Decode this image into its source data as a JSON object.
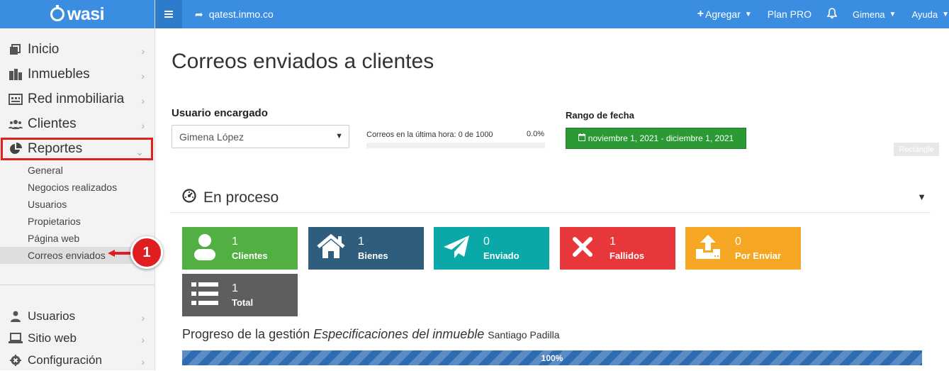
{
  "brand": {
    "name": "wasi"
  },
  "sidebar": {
    "items": [
      {
        "label": "Inicio",
        "icon": "home-icon"
      },
      {
        "label": "Inmuebles",
        "icon": "building-icon"
      },
      {
        "label": "Red inmobiliaria",
        "icon": "network-icon"
      },
      {
        "label": "Clientes",
        "icon": "users-icon"
      },
      {
        "label": "Reportes",
        "icon": "pie-chart-icon",
        "expanded": true
      }
    ],
    "reportes_sub": [
      "General",
      "Negocios realizados",
      "Usuarios",
      "Propietarios",
      "Página web",
      "Correos enviados"
    ],
    "bottom_items": [
      {
        "label": "Usuarios",
        "icon": "user-icon"
      },
      {
        "label": "Sitio web",
        "icon": "laptop-icon"
      },
      {
        "label": "Configuración",
        "icon": "gear-icon"
      }
    ],
    "callout_number": "1"
  },
  "topbar": {
    "site": "qatest.inmo.co",
    "add_label": "Agregar",
    "plan_label": "Plan PRO",
    "user_label": "Gimena",
    "help_label": "Ayuda"
  },
  "main": {
    "title": "Correos enviados a clientes",
    "user_filter_label": "Usuario encargado",
    "user_selected": "Gimena López",
    "hour_text": "Correos en la última hora: 0 de 1000",
    "hour_pct": "0.0%",
    "hour_progress": 0,
    "range_label": "Rango de fecha",
    "date_range": "noviembre 1, 2021 - diciembre 1, 2021",
    "rect_label": "Rectangle",
    "section_title": "En proceso",
    "tiles": [
      {
        "value": "1",
        "label": "Clientes",
        "color": "#52b043",
        "icon": "user-icon"
      },
      {
        "value": "1",
        "label": "Bienes",
        "color": "#2f5d7e",
        "icon": "house-icon"
      },
      {
        "value": "0",
        "label": "Enviado",
        "color": "#0aa9a7",
        "icon": "paper-plane-icon"
      },
      {
        "value": "1",
        "label": "Fallidos",
        "color": "#e8373b",
        "icon": "x-icon"
      },
      {
        "value": "0",
        "label": "Por Enviar",
        "color": "#f5a623",
        "icon": "upload-icon"
      },
      {
        "value": "1",
        "label": "Total",
        "color": "#5e5e5e",
        "icon": "list-icon"
      }
    ],
    "progress": {
      "prefix": "Progreso de la gestión",
      "italic": "Especificaciones del inmueble",
      "suffix": "Santiago Padilla",
      "value": 100,
      "label": "100%"
    }
  }
}
